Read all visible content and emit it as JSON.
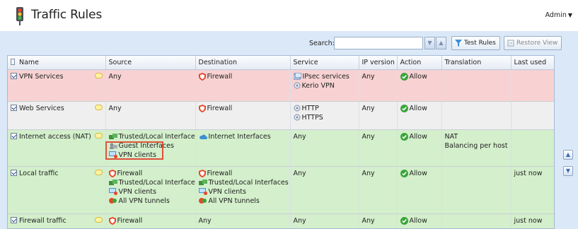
{
  "header": {
    "title": "Traffic Rules",
    "admin_label": "Admin"
  },
  "toolbar": {
    "search_label": "Search:",
    "search_value": "",
    "test_rules_label": "Test Rules",
    "restore_view_label": "Restore View"
  },
  "columns": {
    "name": "Name",
    "source": "Source",
    "destination": "Destination",
    "service": "Service",
    "ip_version": "IP version",
    "action": "Action",
    "translation": "Translation",
    "last_used": "Last used"
  },
  "rows": [
    {
      "name": "VPN Services",
      "source": [
        "Any"
      ],
      "destination": [
        "Firewall"
      ],
      "service": [
        "IPsec services",
        "Kerio VPN"
      ],
      "ip_version": "Any",
      "action": "Allow",
      "translation": [
        "",
        ""
      ],
      "last_used": ""
    },
    {
      "name": "Web Services",
      "source": [
        "Any"
      ],
      "destination": [
        "Firewall"
      ],
      "service": [
        "HTTP",
        "HTTPS"
      ],
      "ip_version": "Any",
      "action": "Allow",
      "translation": [
        "",
        ""
      ],
      "last_used": ""
    },
    {
      "name": "Internet access (NAT)",
      "source": [
        "Trusted/Local Interfaces",
        "Guest Interfaces",
        "VPN clients"
      ],
      "destination": [
        "Internet Interfaces"
      ],
      "service": [
        "Any"
      ],
      "ip_version": "Any",
      "action": "Allow",
      "translation": [
        "NAT",
        "Balancing per host"
      ],
      "last_used": ""
    },
    {
      "name": "Local traffic",
      "source": [
        "Firewall",
        "Trusted/Local Interfaces",
        "VPN clients",
        "All VPN tunnels"
      ],
      "destination": [
        "Firewall",
        "Trusted/Local Interfaces",
        "VPN clients",
        "All VPN tunnels"
      ],
      "service": [
        "Any"
      ],
      "ip_version": "Any",
      "action": "Allow",
      "translation": [
        "",
        ""
      ],
      "last_used": "just now"
    },
    {
      "name": "Firewall traffic",
      "source": [
        "Firewall"
      ],
      "destination": [
        "Any"
      ],
      "service": [
        "Any"
      ],
      "ip_version": "Any",
      "action": "Allow",
      "translation": [
        "",
        ""
      ],
      "last_used": "just now"
    }
  ],
  "icons": {
    "app": "traffic-light-icon",
    "firewall": "shield-icon",
    "interfaces": "network-interfaces-icon",
    "vpn": "vpn-clients-icon",
    "service": "service-icon",
    "allow": "check-circle-icon",
    "note": "comment-icon"
  },
  "colors": {
    "row_vpn": "#f8d2d2",
    "row_web": "#efefef",
    "row_green": "#d3efcb",
    "allow": "#3aa53a",
    "firewall": "#e8452a",
    "highlight": "#e0513a"
  }
}
